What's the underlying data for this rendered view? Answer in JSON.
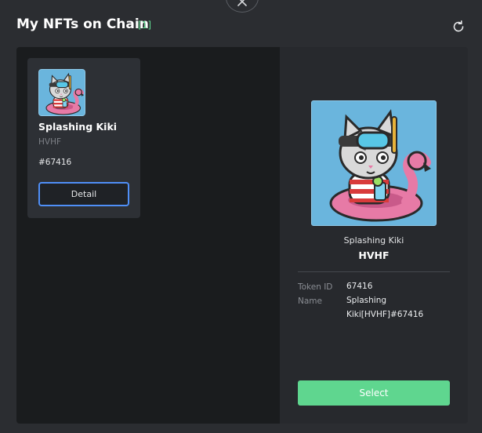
{
  "modal": {
    "title": "My NFTs on Chain",
    "count_badge": "[1]"
  },
  "nft_list": [
    {
      "name": "Splashing Kiki",
      "collection": "HVHF",
      "token": "#67416",
      "button_label": "Detail"
    }
  ],
  "detail": {
    "name": "Splashing Kiki",
    "collection": "HVHF",
    "properties": [
      {
        "label": "Token ID",
        "value": "67416"
      },
      {
        "label": "Name",
        "value": "Splashing Kiki[HVHF]#67416"
      }
    ],
    "select_label": "Select"
  },
  "icons": {
    "close": "close-icon",
    "refresh": "refresh-icon"
  },
  "colors": {
    "accent_green": "#5fd890",
    "select_button": "#5fd68f",
    "focus_border": "#4f8ff7",
    "background": "#2b2d31"
  }
}
